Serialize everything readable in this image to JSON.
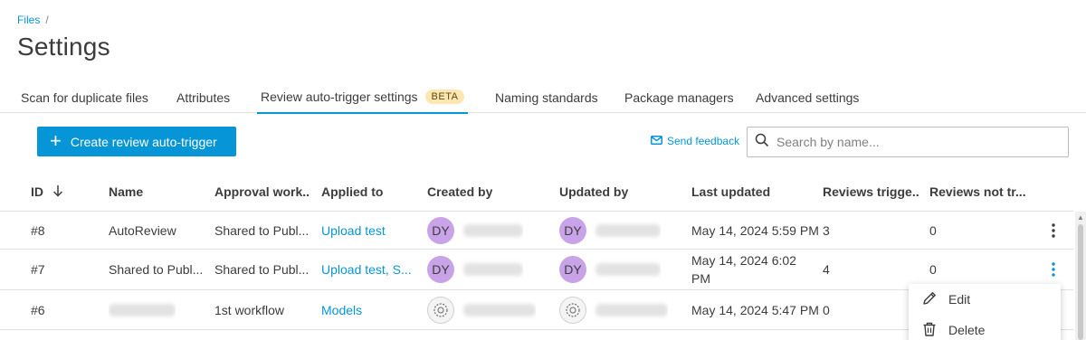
{
  "breadcrumb": {
    "items": [
      "Files"
    ],
    "separator": "/"
  },
  "page": {
    "title": "Settings"
  },
  "tabs": [
    {
      "label": "Scan for duplicate files"
    },
    {
      "label": "Attributes"
    },
    {
      "label": "Review auto-trigger settings",
      "badge": "BETA",
      "active": true
    },
    {
      "label": "Naming standards"
    },
    {
      "label": "Package managers"
    },
    {
      "label": "Advanced settings"
    }
  ],
  "toolbar": {
    "create_label": "Create review auto-trigger",
    "feedback_label": "Send feedback",
    "search_placeholder": "Search by name..."
  },
  "table": {
    "headers": {
      "id": "ID",
      "name": "Name",
      "approval": "Approval work...",
      "applied": "Applied to",
      "created": "Created by",
      "updated": "Updated by",
      "last_updated": "Last updated",
      "reviews_triggered": "Reviews trigge...",
      "reviews_not": "Reviews not tr..."
    },
    "rows": [
      {
        "id": "#8",
        "name": "AutoReview",
        "approval": "Shared to Publ...",
        "applied": "Upload test",
        "created_initials": "DY",
        "updated_initials": "DY",
        "last_updated": "May 14, 2024 5:59 PM",
        "reviews_triggered": "3",
        "reviews_not": "0"
      },
      {
        "id": "#7",
        "name": "Shared to Publ...",
        "approval": "Shared to Publ...",
        "applied": "Upload test, S...",
        "created_initials": "DY",
        "updated_initials": "DY",
        "last_updated": "May 14, 2024 6:02 PM",
        "reviews_triggered": "4",
        "reviews_not": "0"
      },
      {
        "id": "#6",
        "name": "",
        "approval": "1st workflow",
        "applied": "Models",
        "created_initials": "",
        "updated_initials": "",
        "last_updated": "May 14, 2024 5:47 PM",
        "reviews_triggered": "0",
        "reviews_not": ""
      }
    ]
  },
  "context_menu": {
    "edit_label": "Edit",
    "delete_label": "Delete"
  },
  "colors": {
    "accent": "#0696d7",
    "avatar": "#c9a3e8",
    "beta_bg": "#fde6b0"
  }
}
